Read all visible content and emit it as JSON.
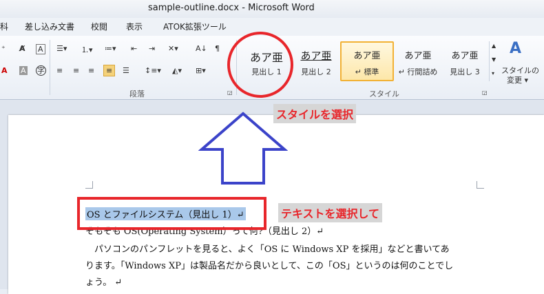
{
  "window": {
    "title": "sample-outline.docx - Microsoft Word"
  },
  "tabs": [
    "科",
    "差し込み文書",
    "校閲",
    "表示",
    "ATOK拡張ツール"
  ],
  "ribbon": {
    "paragraph_group_label": "段落",
    "styles_group_label": "スタイル",
    "change_styles_label_1": "スタイルの",
    "change_styles_label_2": "変更 ▾",
    "styles": [
      {
        "sample": "あア亜",
        "label": "見出し 1"
      },
      {
        "sample": "あア亜",
        "label": "見出し 2"
      },
      {
        "sample": "あア亜",
        "label": "↵ 標準"
      },
      {
        "sample": "あア亜",
        "label": "↵ 行間詰め"
      },
      {
        "sample": "あア亜",
        "label": "見出し 3"
      }
    ]
  },
  "annotations": {
    "select_style": "スタイルを選択",
    "select_text": "テキストを選択して"
  },
  "document": {
    "lines": [
      "OS とファイルシステム（見出し 1）↵",
      "そもそも OS(Operating System）って何?（見出し 2）↵",
      "　パソコンのパンフレットを見ると、よく「OS に Windows XP を採用」などと書いてあ",
      "ります。「Windows XP」は製品名だから良いとして、この「OS」というのは何のことでし",
      "ょう。 ↵"
    ]
  },
  "colors": {
    "annotation_red": "#e8262b",
    "arrow_blue": "#3b43c9",
    "selection": "#a9c8ea",
    "selected_style_border": "#f2b134"
  }
}
